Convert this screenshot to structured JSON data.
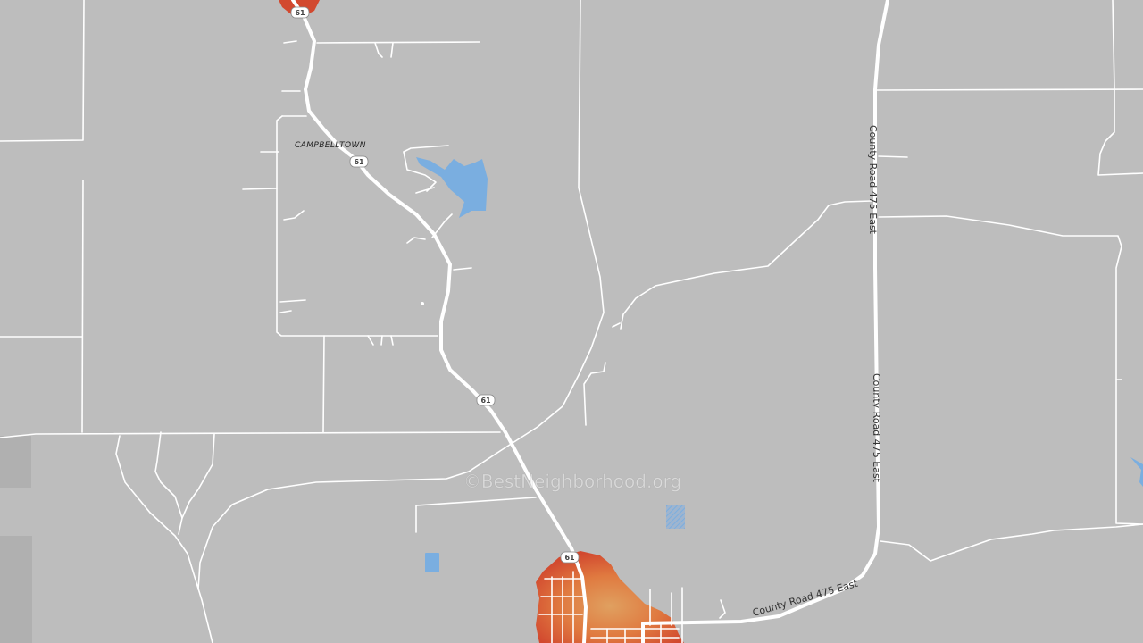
{
  "place_label": "CAMPBELLTOWN",
  "highway_shield": "61",
  "road_labels": {
    "county_road_vertical": "County Road 475 East",
    "county_road_horizontal": "County Road 475 East"
  },
  "watermark": "©BestNeighborhood.org",
  "colors": {
    "background": "#bdbdbd",
    "road": "#ffffff",
    "water": "#7aaee0",
    "heat_core": "#d2492f",
    "heat_edge": "#e07a40",
    "shield_bg": "#ffffff"
  }
}
